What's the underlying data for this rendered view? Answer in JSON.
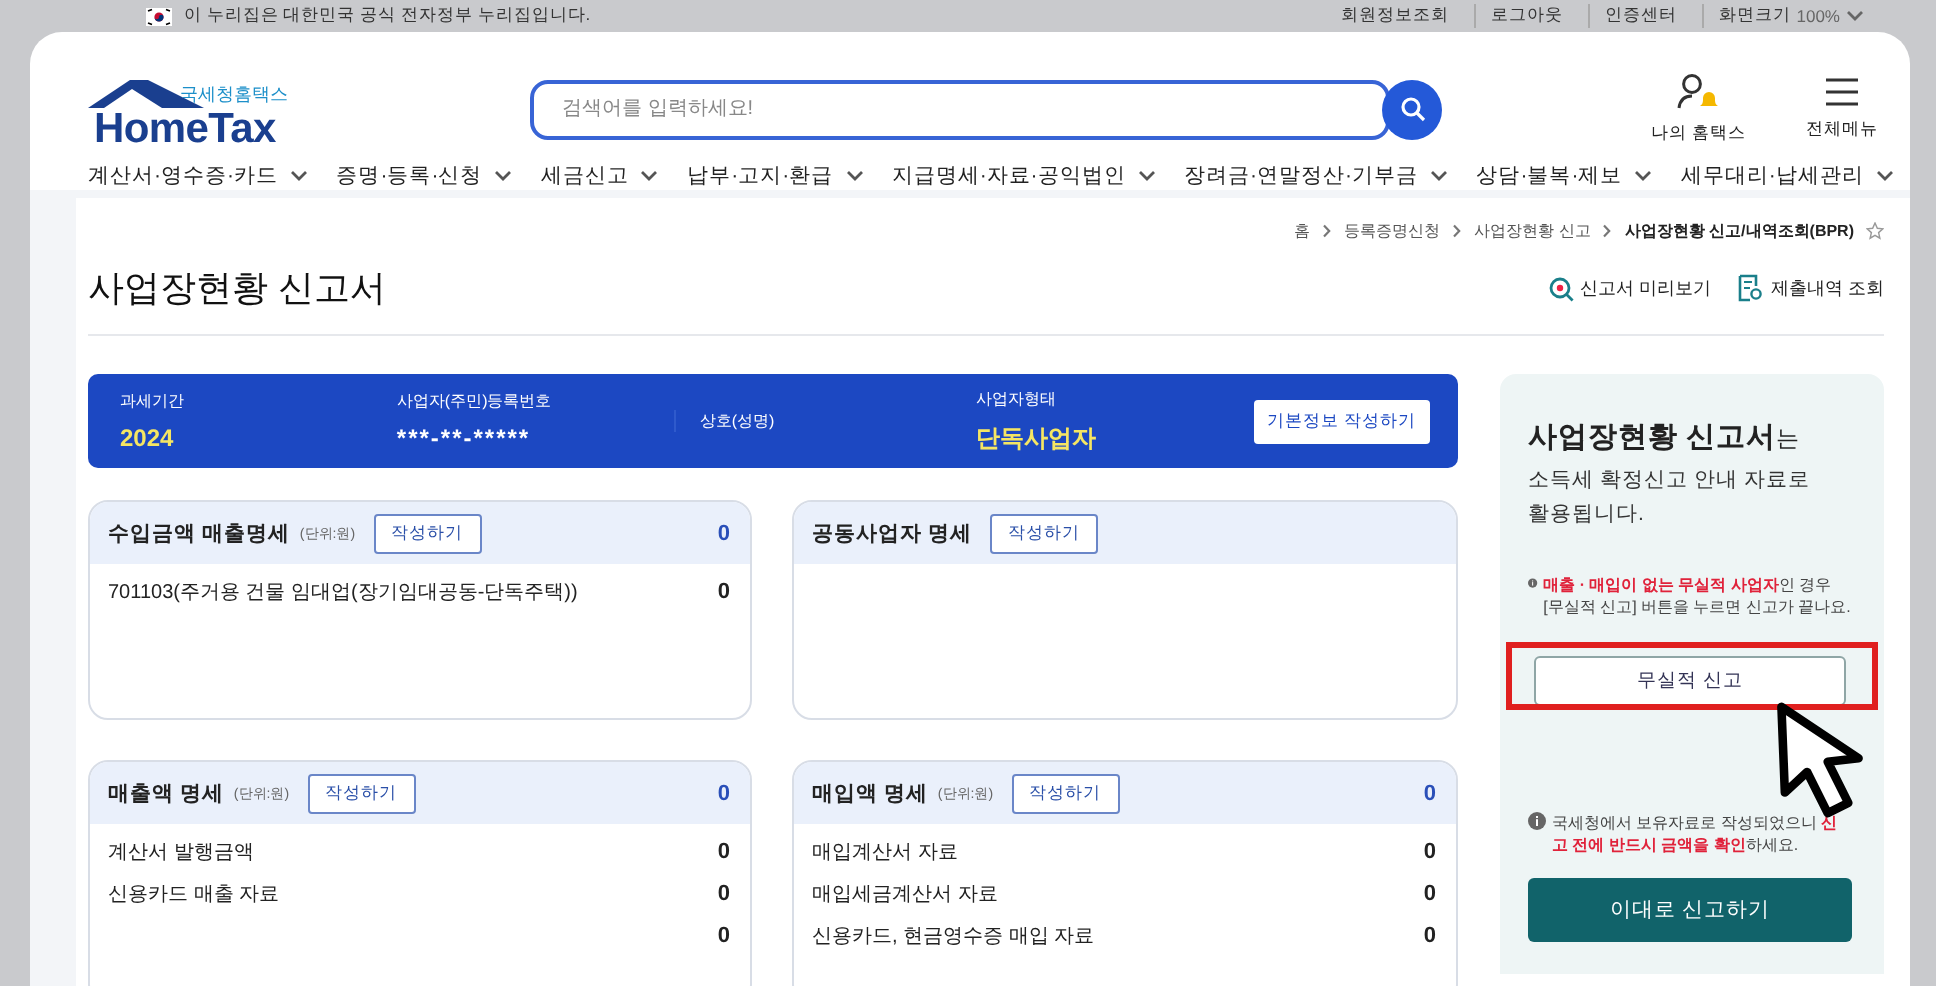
{
  "gov_banner": {
    "text": "이 누리집은 대한민국 공식 전자정부 누리집입니다.",
    "links": [
      "회원정보조회",
      "로그아웃",
      "인증센터"
    ],
    "zoom": {
      "label": "화면크기",
      "value": "100%"
    }
  },
  "header": {
    "logo_caption": "국세청홈택스",
    "logo_text": "HomeTax",
    "search": {
      "placeholder": "검색어를 입력하세요!"
    },
    "actions": [
      {
        "kind": "my",
        "label": "나의 홈택스"
      },
      {
        "kind": "menu",
        "label": "전체메뉴"
      }
    ]
  },
  "nav": [
    "계산서·영수증·카드",
    "증명·등록·신청",
    "세금신고",
    "납부·고지·환급",
    "지급명세·자료·공익법인",
    "장려금·연말정산·기부금",
    "상담·불복·제보",
    "세무대리·납세관리"
  ],
  "breadcrumb": [
    "홈",
    "등록증명신청",
    "사업장현황 신고",
    "사업장현황 신고/내역조회(BPR)"
  ],
  "title": "사업장현황 신고서",
  "title_links": [
    {
      "kind": "preview",
      "label": "신고서 미리보기"
    },
    {
      "kind": "history",
      "label": "제출내역 조회"
    }
  ],
  "summary": {
    "fields": [
      {
        "label": "과세기간",
        "value": "2024"
      },
      {
        "label": "사업자(주민)등록번호",
        "value": "***-**-*****"
      },
      {
        "label": "상호(성명)"
      },
      {
        "label": "사업자형태",
        "value": "단독사업자"
      }
    ],
    "button": "기본정보 작성하기"
  },
  "cards": [
    {
      "title": "수입금액 매출명세",
      "unit": "(단위:원)",
      "button": "작성하기",
      "total": "0",
      "rows": [
        {
          "label": "701103(주거용 건물 임대업(장기임대공동-단독주택))",
          "value": "0"
        }
      ]
    },
    {
      "title": "공동사업자 명세",
      "button": "작성하기"
    },
    {
      "title": "매출액 명세",
      "unit": "(단위:원)",
      "button": "작성하기",
      "total": "0",
      "rows": [
        {
          "label": "계산서 발행금액",
          "value": "0"
        },
        {
          "label": "신용카드 매출 자료",
          "value": "0"
        },
        {
          "value": "0"
        }
      ]
    },
    {
      "title": "매입액 명세",
      "unit": "(단위:원)",
      "button": "작성하기",
      "total": "0",
      "rows": [
        {
          "label": "매입계산서 자료",
          "value": "0"
        },
        {
          "label": "매입세금계산서 자료",
          "value": "0"
        },
        {
          "label": "신용카드, 현금영수증 매입 자료",
          "value": "0"
        }
      ]
    }
  ],
  "sidebar": {
    "heading": "**사업장현황 신고서**는",
    "intro": "소득세 확정신고 안내 자료로 활용됩니다.",
    "note_1": "**매출 · 매입이 없는 무실적 사업자**인 경우 [무실적 신고] 버튼을 누르면 신고가 끝나요.",
    "nil_button": "무실적 신고",
    "note_2": "국세청에서 보유자료로 작성되었으니 **신고 전에 반드시 금액을 확인**하세요.",
    "submit_button": "이대로 신고하기"
  }
}
